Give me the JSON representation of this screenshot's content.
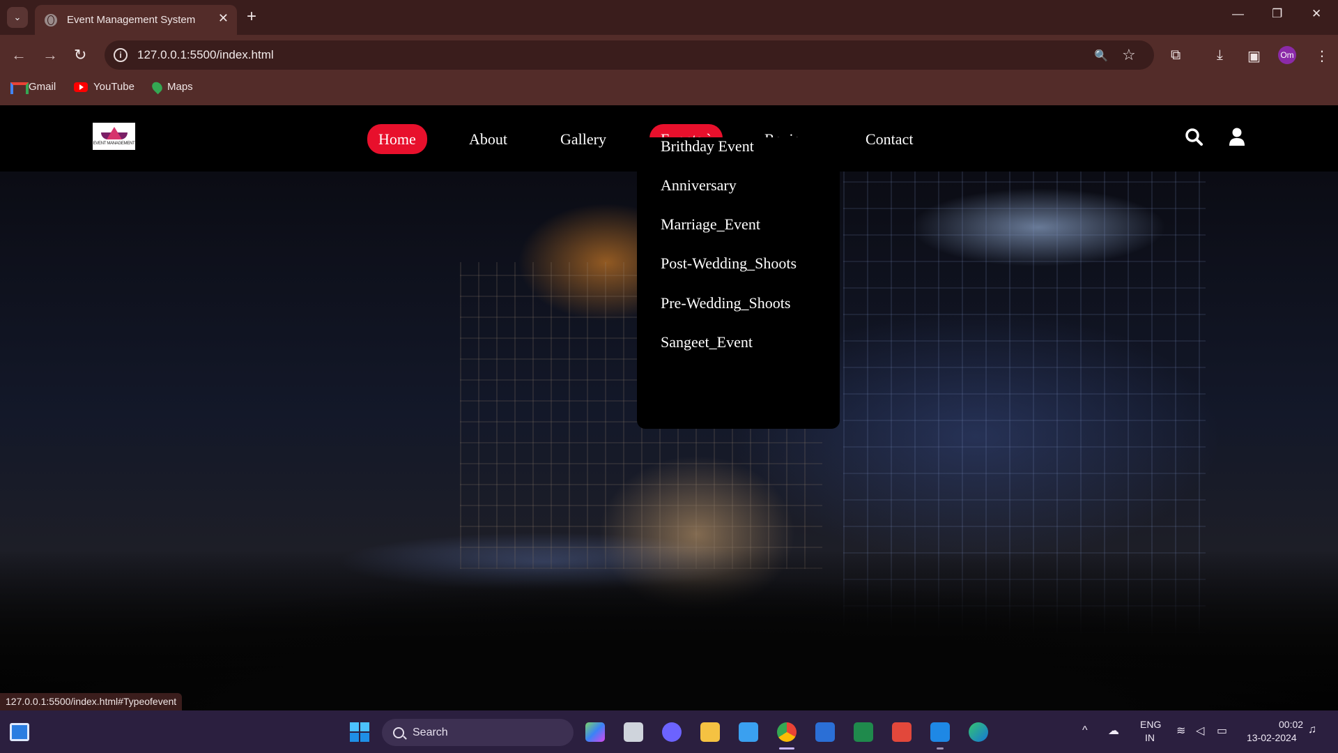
{
  "browser": {
    "tab_title": "Event Management System",
    "tab_close": "✕",
    "new_tab": "+",
    "url": "127.0.0.1:5500/index.html",
    "profile_initials": "Om",
    "bookmarks": [
      "Gmail",
      "YouTube",
      "Maps"
    ],
    "status_url": "127.0.0.1:5500/index.html#Typeofevent",
    "window_controls": {
      "minimize": "—",
      "restore": "❐",
      "close": "✕"
    },
    "nav": {
      "back": "←",
      "forward": "→",
      "reload": "↻"
    },
    "icons": {
      "zoom": "🔍",
      "star": "☆",
      "extensions": "⧉",
      "download": "⤓",
      "sidepanel": "▣",
      "menu": "⋮"
    }
  },
  "site": {
    "logo_text": "EVENT MANAGEMENT",
    "nav": [
      "Home",
      "About",
      "Gallery",
      "Events `",
      "Review",
      "Contact"
    ],
    "active_nav": "Home",
    "accent_color": "#e8102c",
    "events_dropdown": [
      "Brithday Event",
      "Anniversary",
      "Marriage_Event",
      "Post-Wedding_Shoots",
      "Pre-Wedding_Shoots",
      "Sangeet_Event"
    ],
    "icons": [
      "search-icon",
      "user-icon"
    ]
  },
  "taskbar": {
    "search_label": "Search",
    "language": "ENG",
    "region": "IN",
    "time": "00:02",
    "date": "13-02-2024"
  }
}
